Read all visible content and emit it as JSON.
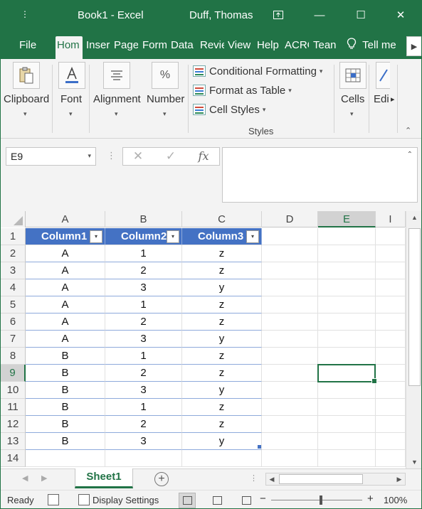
{
  "titlebar": {
    "qat_icon": "⋮",
    "title": "Book1  -  Excel",
    "user": "Duff, Thomas",
    "ribbon_display_icon": "ribbon-display-icon",
    "minimize": "—",
    "maximize": "☐",
    "close": "✕"
  },
  "tabs": {
    "file": "File",
    "home": "Hom",
    "insert": "Inser",
    "page_layout": "Page",
    "formulas": "Form",
    "data": "Data",
    "review": "Revie",
    "view": "View",
    "help": "Help",
    "acrobat": "ACRO",
    "team": "Tean",
    "tell_me": "Tell me",
    "tell_me_icon": "lightbulb-icon",
    "scroll_right": "▶"
  },
  "ribbon": {
    "clipboard": "Clipboard",
    "font": "Font",
    "alignment": "Alignment",
    "number": "Number",
    "number_icon": "%",
    "conditional_formatting": "Conditional Formatting",
    "format_as_table": "Format as Table",
    "cell_styles": "Cell Styles",
    "styles_group": "Styles",
    "cells": "Cells",
    "editing": "Edi",
    "caret": "▾",
    "collapse": "⌃"
  },
  "formula_bar": {
    "name_box": "E9",
    "dots": "⋮",
    "cancel": "✕",
    "enter": "✓",
    "fx": "fx",
    "value": ""
  },
  "grid": {
    "columns": [
      "A",
      "B",
      "C",
      "D",
      "E",
      "I"
    ],
    "selected_column": "E",
    "rows": [
      "1",
      "2",
      "3",
      "4",
      "5",
      "6",
      "7",
      "8",
      "9",
      "10",
      "11",
      "12",
      "13",
      "14"
    ],
    "selected_row": "9",
    "table_headers": [
      "Column1",
      "Column2",
      "Column3"
    ],
    "filter_glyph": "▾",
    "table_rows": [
      [
        "A",
        "1",
        "z"
      ],
      [
        "A",
        "2",
        "z"
      ],
      [
        "A",
        "3",
        "y"
      ],
      [
        "A",
        "1",
        "z"
      ],
      [
        "A",
        "2",
        "z"
      ],
      [
        "A",
        "3",
        "y"
      ],
      [
        "B",
        "1",
        "z"
      ],
      [
        "B",
        "2",
        "z"
      ],
      [
        "B",
        "3",
        "y"
      ],
      [
        "B",
        "1",
        "z"
      ],
      [
        "B",
        "2",
        "z"
      ],
      [
        "B",
        "3",
        "y"
      ]
    ]
  },
  "scroll": {
    "up": "▲",
    "down": "▼",
    "left": "◀",
    "right": "▶"
  },
  "sheets": {
    "prev": "◀",
    "next": "▶",
    "active": "Sheet1",
    "add": "+"
  },
  "status": {
    "ready": "Ready",
    "display_settings": "Display Settings",
    "zoom_out": "−",
    "zoom_in": "+",
    "zoom": "100%",
    "zoom_level": 1.0
  }
}
